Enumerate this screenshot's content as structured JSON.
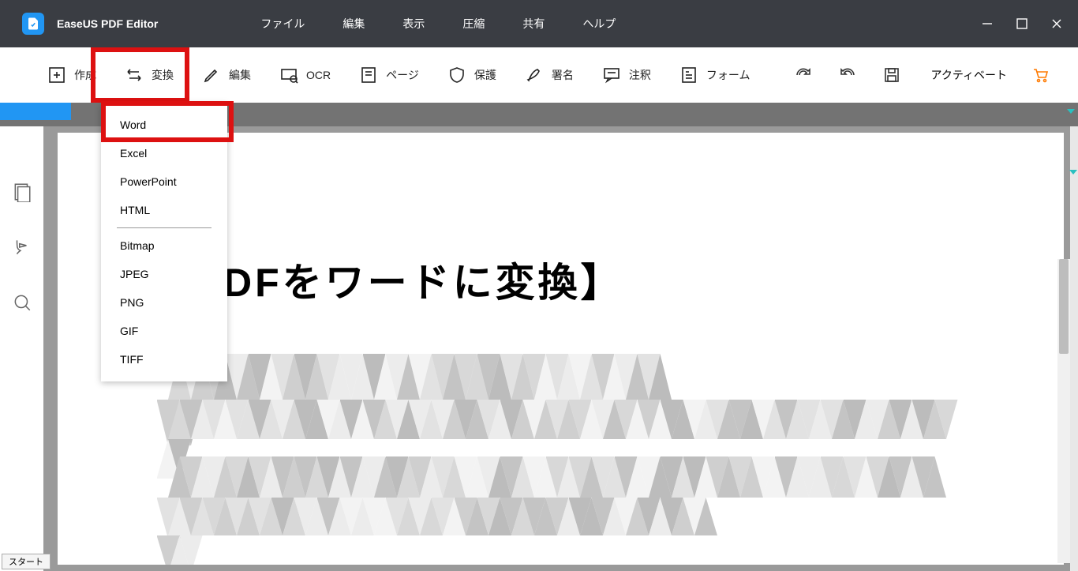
{
  "titlebar": {
    "app_name": "EaseUS PDF Editor",
    "menu": [
      "ファイル",
      "編集",
      "表示",
      "圧縮",
      "共有",
      "ヘルプ"
    ]
  },
  "toolbar": {
    "create": "作成",
    "convert": "変換",
    "edit": "編集",
    "ocr": "OCR",
    "page": "ページ",
    "protect": "保護",
    "sign": "署名",
    "annotate": "注釈",
    "form": "フォーム",
    "activate": "アクティベート"
  },
  "convert_menu": {
    "items_group1": [
      "Word",
      "Excel",
      "PowerPoint",
      "HTML"
    ],
    "items_group2": [
      "Bitmap",
      "JPEG",
      "PNG",
      "GIF",
      "TIFF"
    ]
  },
  "document": {
    "heading_visible": "DFをワードに変換】"
  },
  "footer": {
    "start": "スタート"
  }
}
